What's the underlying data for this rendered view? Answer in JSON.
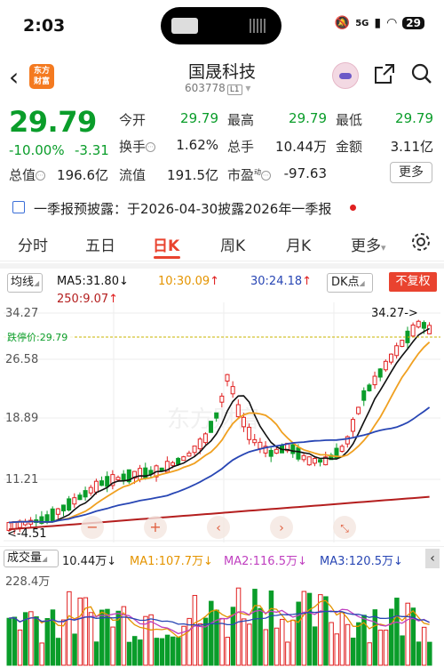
{
  "status_bar": {
    "time": "2:03",
    "network": "5G",
    "battery": "29"
  },
  "header": {
    "stock_name": "国晟科技",
    "stock_code": "603778",
    "level": "L1",
    "logo_text": "东方财富"
  },
  "quote": {
    "price": "29.79",
    "change_pct": "-10.00%",
    "change": "-3.31",
    "fields": [
      {
        "label": "今开",
        "value": "29.79"
      },
      {
        "label": "最高",
        "value": "29.79"
      },
      {
        "label": "最低",
        "value": "29.79"
      },
      {
        "label": "换手",
        "value": "1.62%"
      },
      {
        "label": "总手",
        "value": "10.44万"
      },
      {
        "label": "金额",
        "value": "3.11亿"
      },
      {
        "label": "总值",
        "value": "196.6亿"
      },
      {
        "label": "流值",
        "value": "191.5亿"
      },
      {
        "label": "市盈",
        "value": "-97.63"
      }
    ],
    "pe_superscript": "动",
    "more_label": "更多"
  },
  "notice": {
    "text": "一季报预披露：于2026-04-30披露2026年一季报"
  },
  "tabs": [
    {
      "label": "分时"
    },
    {
      "label": "五日"
    },
    {
      "label": "日K"
    },
    {
      "label": "周K"
    },
    {
      "label": "月K"
    },
    {
      "label": "更多"
    }
  ],
  "kline": {
    "indicator": "均线",
    "ma5": "MA5:31.80",
    "ma10": "10:30.09",
    "ma30": "30:24.18",
    "ma250": "250:9.07",
    "dk_label": "DK点",
    "adjust_label": "不复权",
    "y_ticks": [
      "34.27",
      "26.58",
      "18.89",
      "11.21"
    ],
    "limit_down_label": "跌停价:29.79",
    "high_marker": "34.27->",
    "low_marker": "<-4.51",
    "watermark": "东方财富",
    "colors": {
      "up": "#e02020",
      "down": "#0a9d2a",
      "ma5": "#111111",
      "ma10": "#f0a020",
      "ma30": "#2846b4",
      "ma250": "#b41e1e"
    }
  },
  "volume": {
    "label": "成交量",
    "value": "10.44万",
    "ma1": "MA1:107.7万",
    "ma2": "MA2:116.5万",
    "ma3": "MA3:120.5万",
    "max_tick": "228.4万"
  },
  "arrows": {
    "down": "↓",
    "up": "↑"
  },
  "icons": [
    "back-icon",
    "share-icon",
    "search-icon",
    "gear-icon",
    "notice-icon",
    "minus-icon",
    "plus-icon",
    "left-icon",
    "right-icon",
    "collapse-icon"
  ]
}
